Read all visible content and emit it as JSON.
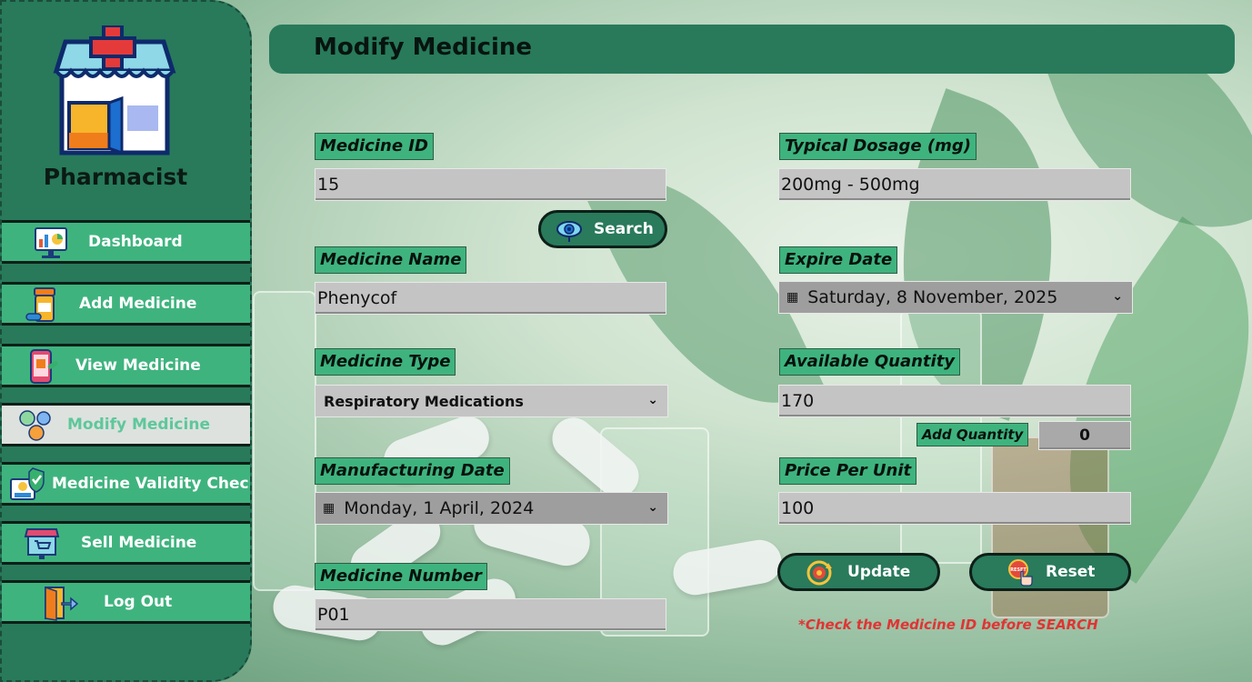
{
  "app": {
    "role": "Pharmacist"
  },
  "sidebar": {
    "items": [
      {
        "label": "Dashboard",
        "icon": "dashboard-chart-icon"
      },
      {
        "label": "Add Medicine",
        "icon": "medicine-bottle-icon"
      },
      {
        "label": "View Medicine",
        "icon": "phone-medicine-icon"
      },
      {
        "label": "Modify Medicine",
        "icon": "modify-circles-icon",
        "active": true
      },
      {
        "label": "Medicine Validity Check",
        "icon": "validity-check-icon"
      },
      {
        "label": "Sell Medicine",
        "icon": "shop-cart-icon"
      },
      {
        "label": "Log Out",
        "icon": "logout-door-icon"
      }
    ]
  },
  "header": {
    "title": "Modify Medicine"
  },
  "form": {
    "medicine_id": {
      "label": "Medicine ID",
      "value": "15"
    },
    "search_button": "Search",
    "medicine_name": {
      "label": "Medicine Name",
      "value": "Phenycof"
    },
    "medicine_type": {
      "label": "Medicine Type",
      "value": "Respiratory Medications"
    },
    "manufacturing_date": {
      "label": "Manufacturing Date",
      "value": "Monday, 1 April, 2024"
    },
    "medicine_number": {
      "label": "Medicine Number",
      "value": "P01"
    },
    "typical_dosage": {
      "label": "Typical Dosage (mg)",
      "value": "200mg - 500mg"
    },
    "expire_date": {
      "label": "Expire Date",
      "value": "Saturday, 8 November, 2025"
    },
    "available_quantity": {
      "label": "Available Quantity",
      "value": "170"
    },
    "add_quantity": {
      "label": "Add Quantity",
      "value": "0"
    },
    "price_per_unit": {
      "label": "Price Per Unit",
      "value": "100"
    },
    "update_button": "Update",
    "reset_button": "Reset",
    "reset_icon_text": "RESET",
    "note": "*Check the Medicine ID before SEARCH"
  },
  "colors": {
    "sidebar": "#287a5b",
    "nav_item": "#3fb37e",
    "nav_active": "#dde2df",
    "label_bg": "#3fb37e",
    "field_bg": "#c4c4c4",
    "note": "#e03434"
  }
}
